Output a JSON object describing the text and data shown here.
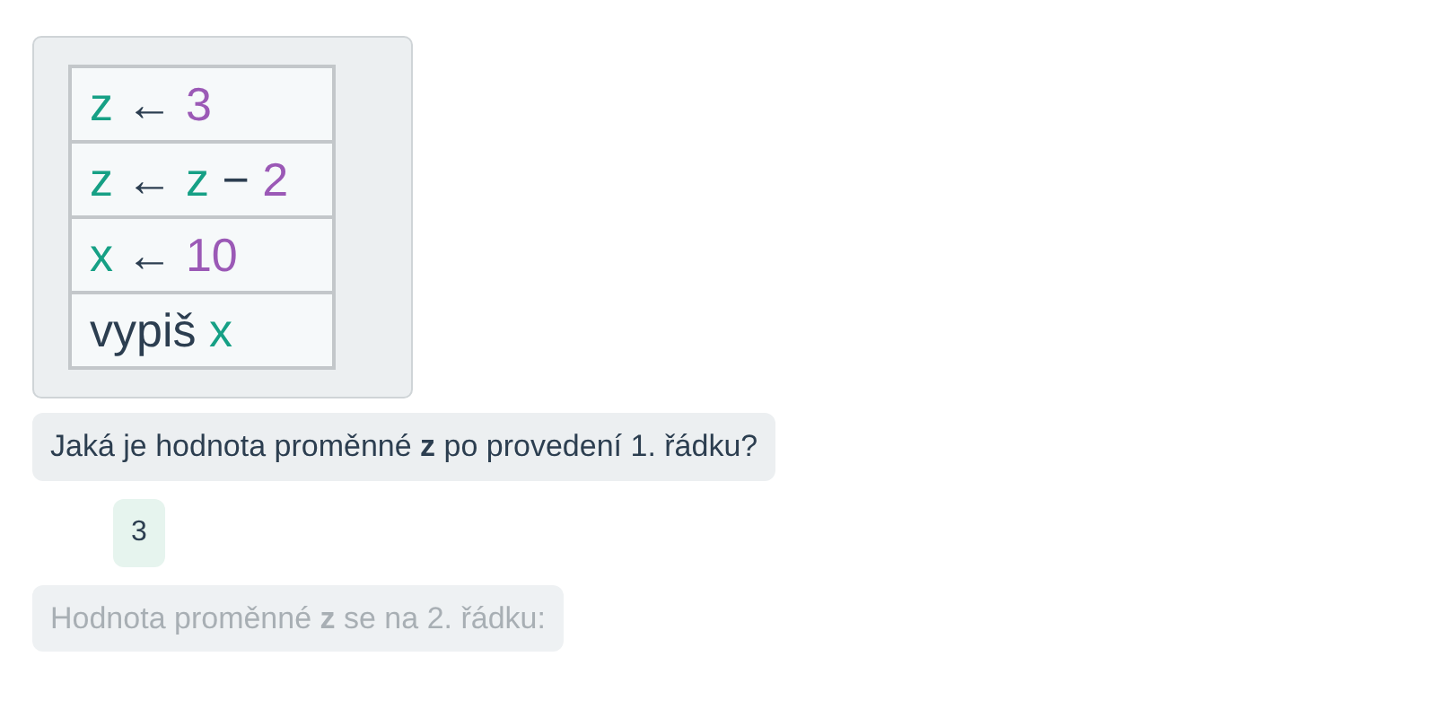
{
  "program": {
    "rows": [
      {
        "tokens": [
          {
            "kind": "var",
            "text": "z"
          },
          {
            "kind": "op",
            "text": "←"
          },
          {
            "kind": "num",
            "text": "3"
          }
        ]
      },
      {
        "tokens": [
          {
            "kind": "var",
            "text": "z"
          },
          {
            "kind": "op",
            "text": "←"
          },
          {
            "kind": "var",
            "text": "z"
          },
          {
            "kind": "op",
            "text": "−"
          },
          {
            "kind": "num",
            "text": "2"
          }
        ]
      },
      {
        "tokens": [
          {
            "kind": "var",
            "text": "x"
          },
          {
            "kind": "op",
            "text": "←"
          },
          {
            "kind": "num",
            "text": "10"
          }
        ]
      },
      {
        "tokens": [
          {
            "kind": "kw",
            "text": "vypiš"
          },
          {
            "kind": "var",
            "text": "x"
          }
        ]
      }
    ]
  },
  "messages": [
    {
      "kind": "question",
      "text": "Jaká je hodnota proměnné **z** po provedení 1. řádku?",
      "faded": false
    },
    {
      "kind": "answer",
      "text": "3",
      "faded": false
    },
    {
      "kind": "question",
      "text": "Hodnota proměnné **z** se na 2. řádku:",
      "faded": true
    }
  ]
}
